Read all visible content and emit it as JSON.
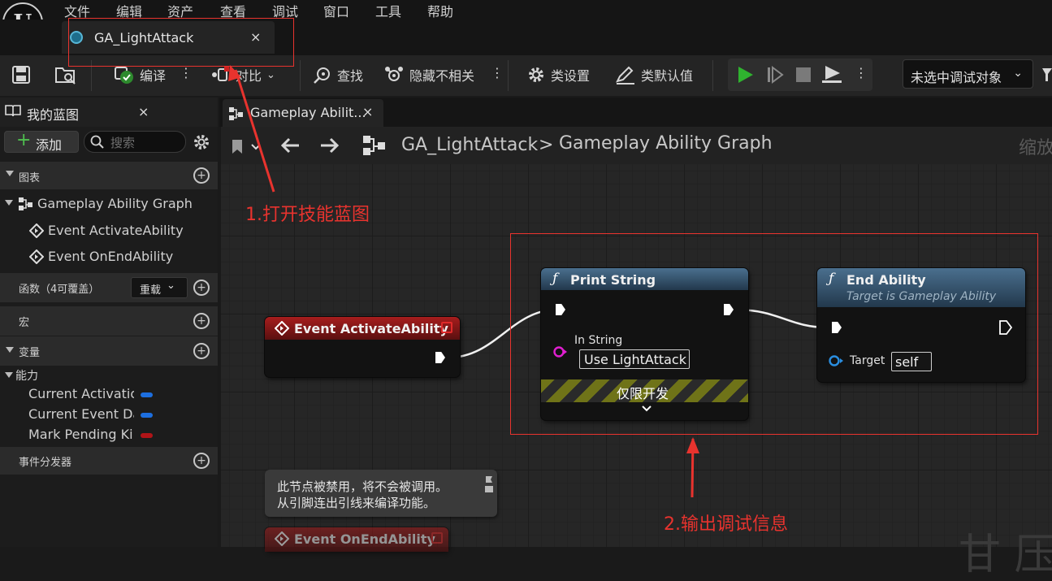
{
  "menu": {
    "items": [
      "文件",
      "编辑",
      "资产",
      "查看",
      "调试",
      "窗口",
      "工具",
      "帮助"
    ]
  },
  "asset_tab": {
    "label": "GA_LightAttack",
    "close": "×"
  },
  "toolbar": {
    "compile": "编译",
    "diff": "对比",
    "find": "查找",
    "hide_unrelated": "隐藏不相关",
    "class_settings": "类设置",
    "class_defaults": "类默认值",
    "debug_object": "未选中调试对象",
    "more": "⋮"
  },
  "my_blueprint": {
    "title": "我的蓝图",
    "close": "×",
    "add_button": "添加",
    "search_placeholder": "搜索",
    "graphs_category": "图表",
    "graph_name": "Gameplay Ability Graph",
    "events": [
      "Event ActivateAbility",
      "Event OnEndAbility"
    ],
    "functions_category": "函数（4可覆盖）",
    "override_dropdown": "重载",
    "macros_category": "宏",
    "variables_category": "变量",
    "variable_group": "能力",
    "variables": [
      {
        "name": "Current Activation Info",
        "color": "#1d6fe0"
      },
      {
        "name": "Current Event Data",
        "color": "#1d6fe0"
      },
      {
        "name": "Mark Pending Kill",
        "color": "#b01418"
      }
    ],
    "dispatchers_category": "事件分发器"
  },
  "graph_tab": {
    "label": "Gameplay Abilit...",
    "close": "×"
  },
  "breadcrumb": {
    "asset": "GA_LightAttack",
    "separator": ">",
    "graph": "Gameplay Ability Graph",
    "zoom_label": "缩放"
  },
  "nodes": {
    "event_activate": {
      "title": "Event ActivateAbility"
    },
    "print_string": {
      "title": "Print String",
      "pin_label": "In String",
      "pin_value": "Use LightAttack",
      "dev_only": "仅限开发"
    },
    "end_ability": {
      "title": "End Ability",
      "subtitle": "Target is Gameplay Ability",
      "target_label": "Target",
      "target_value": "self"
    },
    "event_end": {
      "title": "Event OnEndAbility"
    },
    "disabled_comment": {
      "line1": "此节点被禁用，将不会被调用。",
      "line2": "从引脚连出引线来编译功能。"
    }
  },
  "annotations": {
    "step1": "1.打开技能蓝图",
    "step2": "2.输出调试信息"
  },
  "watermark": "甘 压"
}
